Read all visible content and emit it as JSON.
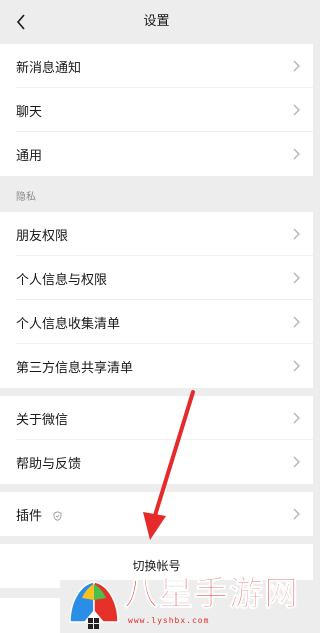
{
  "nav": {
    "title": "设置",
    "back_icon": "chevron-left-icon"
  },
  "group1": [
    {
      "label": "新消息通知"
    },
    {
      "label": "聊天"
    },
    {
      "label": "通用"
    }
  ],
  "privacy": {
    "header": "隐私",
    "items": [
      {
        "label": "朋友权限"
      },
      {
        "label": "个人信息与权限"
      },
      {
        "label": "个人信息收集清单"
      },
      {
        "label": "第三方信息共享清单"
      }
    ]
  },
  "group3": [
    {
      "label": "关于微信"
    },
    {
      "label": "帮助与反馈"
    }
  ],
  "plugins": {
    "label": "插件"
  },
  "switch_account": {
    "label": "切换帐号"
  },
  "watermark": {
    "text": "八星手游网",
    "url": "www.lyshbx.com"
  },
  "colors": {
    "background": "#ededed",
    "row": "#ffffff",
    "text": "#191919",
    "secondary": "#8a8a8a",
    "arrow": "#e62a2a"
  }
}
